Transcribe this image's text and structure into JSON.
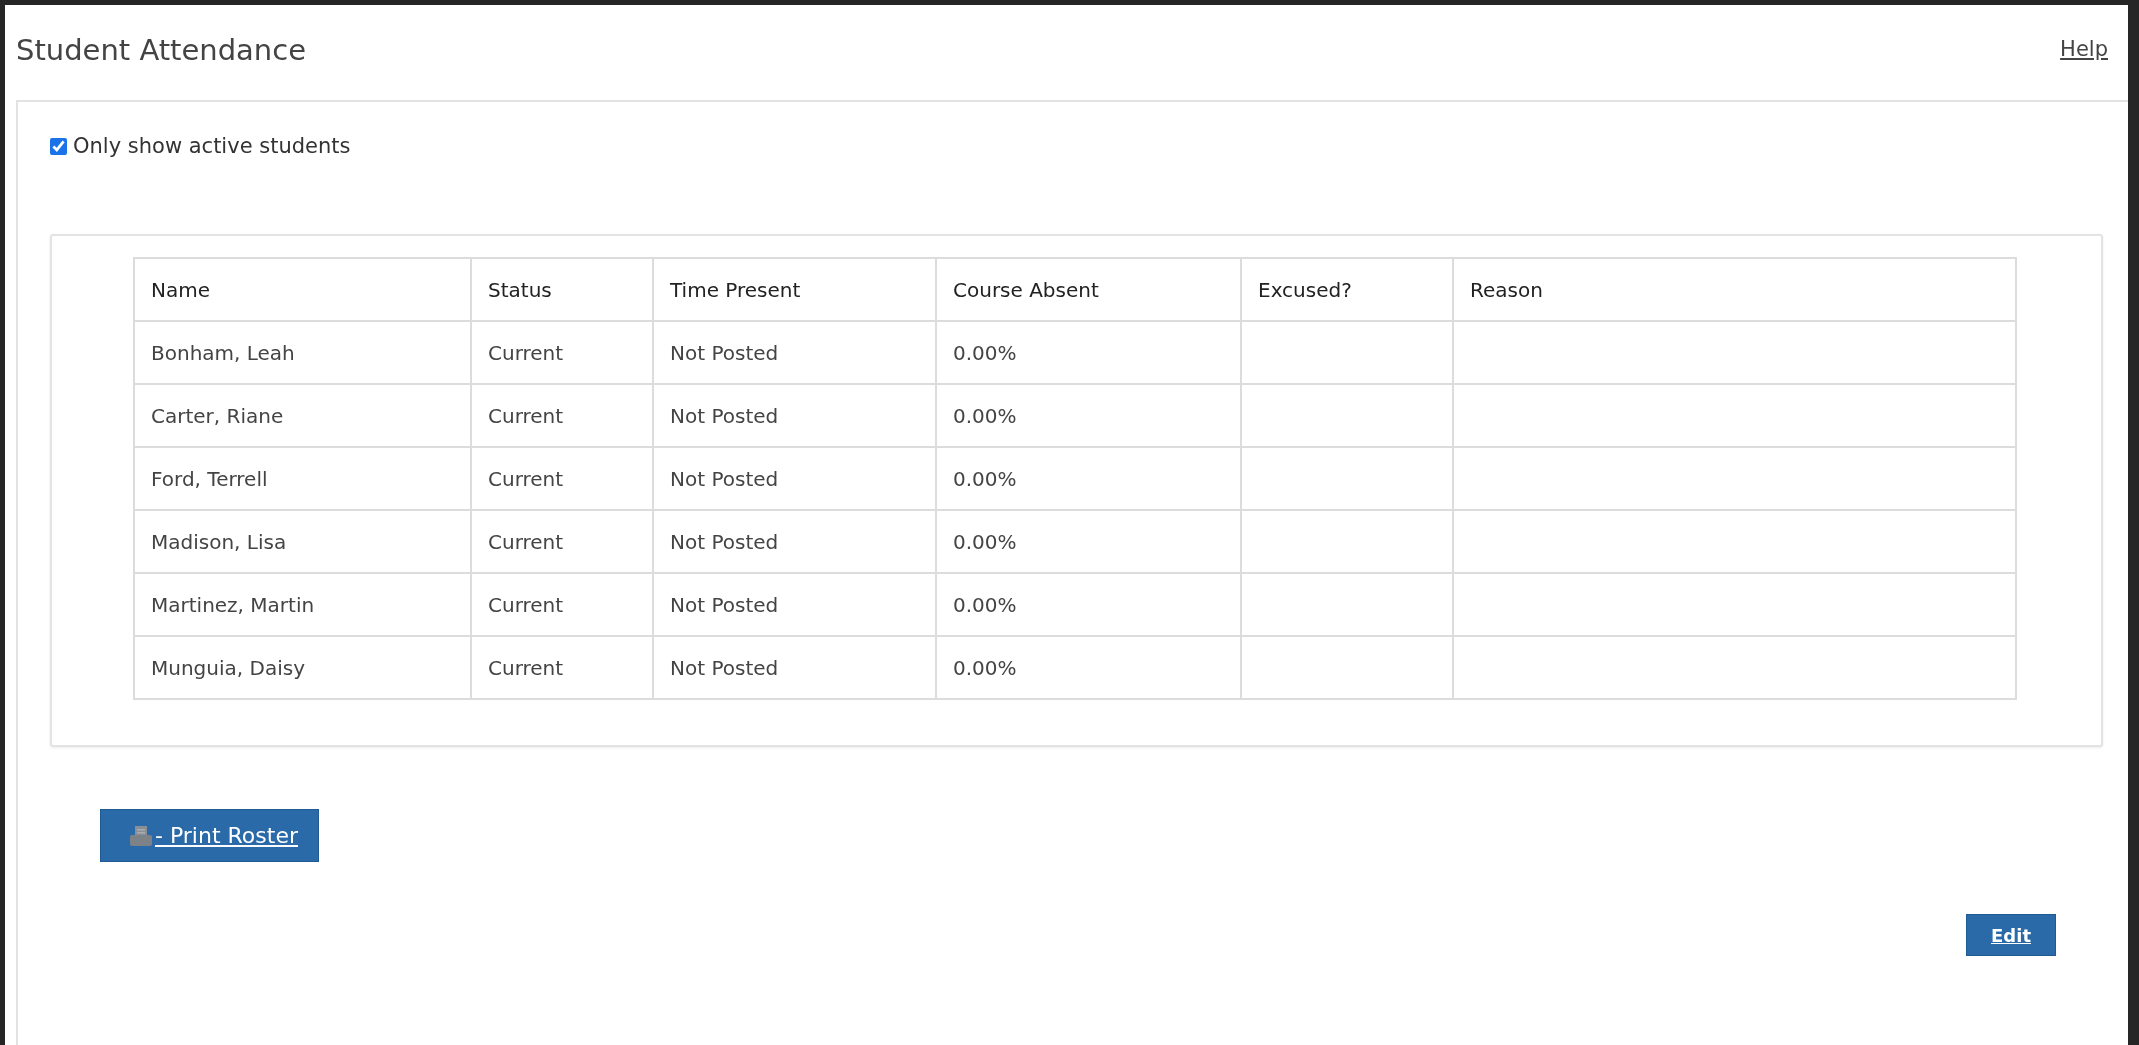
{
  "page": {
    "title": "Student Attendance",
    "help_link": "Help"
  },
  "filter": {
    "label": "Only show active students",
    "checked": true
  },
  "table": {
    "columns": [
      "Name",
      "Status",
      "Time Present",
      "Course Absent",
      "Excused?",
      "Reason"
    ],
    "rows": [
      [
        "Bonham, Leah",
        "Current",
        "Not Posted",
        "0.00%",
        "",
        ""
      ],
      [
        "Carter, Riane",
        "Current",
        "Not Posted",
        "0.00%",
        "",
        ""
      ],
      [
        "Ford, Terrell",
        "Current",
        "Not Posted",
        "0.00%",
        "",
        ""
      ],
      [
        "Madison, Lisa",
        "Current",
        "Not Posted",
        "0.00%",
        "",
        ""
      ],
      [
        "Martinez, Martin",
        "Current",
        "Not Posted",
        "0.00%",
        "",
        ""
      ],
      [
        "Munguia, Daisy",
        "Current",
        "Not Posted",
        "0.00%",
        "",
        ""
      ]
    ]
  },
  "buttons": [
    {
      "kind": "print",
      "label": "- Print Roster"
    },
    {
      "kind": "edit",
      "label": "Edit"
    }
  ]
}
